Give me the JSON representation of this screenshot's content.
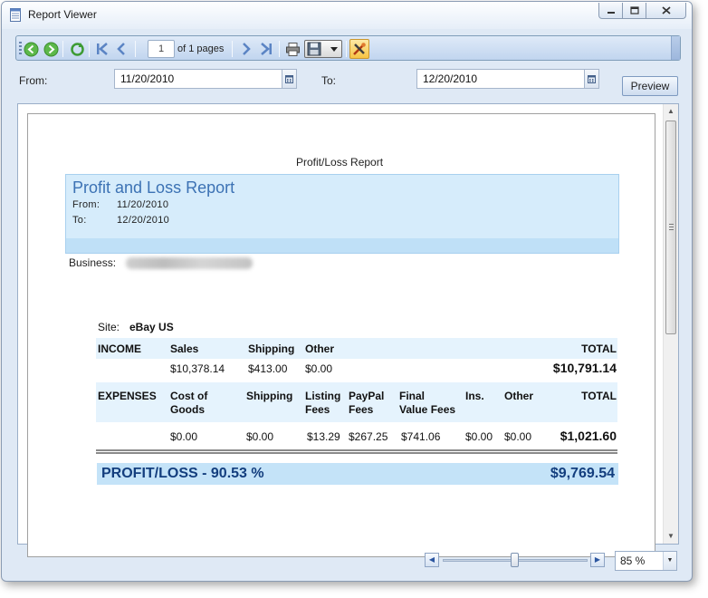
{
  "window": {
    "title": "Report Viewer"
  },
  "toolbar": {
    "page_number": "1",
    "page_of": "of 1 pages"
  },
  "filters": {
    "from_label": "From:",
    "from_value": "11/20/2010",
    "to_label": "To:",
    "to_value": "12/20/2010",
    "preview_label": "Preview"
  },
  "report": {
    "caption": "Profit/Loss Report",
    "title": "Profit and Loss Report",
    "from_label": "From:",
    "from_value": "11/20/2010",
    "to_label": "To:",
    "to_value": "12/20/2010",
    "business_label": "Business:",
    "site_label": "Site:",
    "site_value": "eBay US",
    "income": {
      "label": "INCOME",
      "headers": {
        "sales": "Sales",
        "shipping": "Shipping",
        "other": "Other",
        "total": "TOTAL"
      },
      "values": {
        "sales": "$10,378.14",
        "shipping": "$413.00",
        "other": "$0.00",
        "total": "$10,791.14"
      }
    },
    "expenses": {
      "label": "EXPENSES",
      "headers": {
        "cost_of_goods_1": "Cost of",
        "cost_of_goods_2": "Goods",
        "shipping": "Shipping",
        "listing_fees_1": "Listing",
        "listing_fees_2": "Fees",
        "paypal_fees_1": "PayPal",
        "paypal_fees_2": "Fees",
        "final_value_fees_1": "Final",
        "final_value_fees_2": "Value Fees",
        "ins": "Ins.",
        "other": "Other",
        "total": "TOTAL"
      },
      "values": {
        "cost_of_goods": "$0.00",
        "shipping": "$0.00",
        "listing_fees": "$13.29",
        "paypal_fees": "$267.25",
        "final_value_fees": "$741.06",
        "ins": "$0.00",
        "other": "$0.00",
        "total": "$1,021.60"
      }
    },
    "profit": {
      "label": "PROFIT/LOSS  -  90.53 %",
      "value": "$9,769.54"
    }
  },
  "zoom": {
    "value": "85 %",
    "slider_fraction": 0.5
  },
  "colors": {
    "accent": "#3c72b4",
    "header_fill": "#d6ecfb",
    "profit_text": "#133e7e"
  }
}
